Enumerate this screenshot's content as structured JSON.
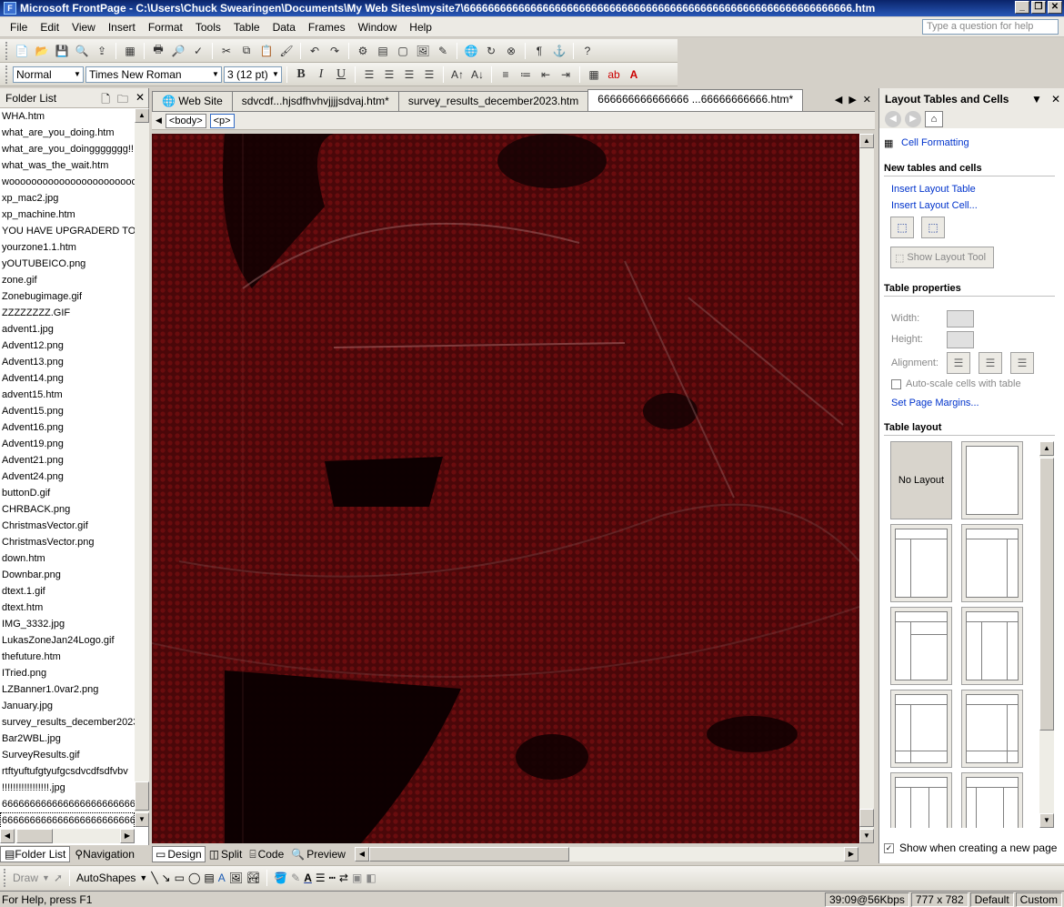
{
  "window": {
    "title": "Microsoft FrontPage - C:\\Users\\Chuck Swearingen\\Documents\\My Web Sites\\mysite7\\6666666666666666666666666666666666666666666666666666666666666666.htm"
  },
  "menu": {
    "items": [
      "File",
      "Edit",
      "View",
      "Insert",
      "Format",
      "Tools",
      "Table",
      "Data",
      "Frames",
      "Window",
      "Help"
    ],
    "help_placeholder": "Type a question for help"
  },
  "formatting": {
    "style": "Normal",
    "font": "Times New Roman",
    "size": "3  (12 pt)",
    "bold": "B",
    "italic": "I",
    "underline": "U"
  },
  "folder_list": {
    "title": "Folder List",
    "files": [
      "WHA.htm",
      "what_are_you_doing.htm",
      "what_are_you_doinggggggg!!",
      "what_was_the_wait.htm",
      "woooooooooooooooooooooooo",
      "xp_mac2.jpg",
      "xp_machine.htm",
      "YOU HAVE UPGRADERD TO PR",
      "yourzone1.1.htm",
      "yOUTUBEICO.png",
      "zone.gif",
      "Zonebugimage.gif",
      "ZZZZZZZZ.GIF",
      "advent1.jpg",
      "Advent12.png",
      "Advent13.png",
      "Advent14.png",
      "advent15.htm",
      "Advent15.png",
      "Advent16.png",
      "Advent19.png",
      "Advent21.png",
      "Advent24.png",
      "buttonD.gif",
      "CHRBACK.png",
      "ChristmasVector.gif",
      "ChristmasVector.png",
      "down.htm",
      "Downbar.png",
      "dtext.1.gif",
      "dtext.htm",
      "IMG_3332.jpg",
      "LukasZoneJan24Logo.gif",
      "thefuture.htm",
      "ITried.png",
      "LZBanner1.0var2.png",
      "January.jpg",
      "survey_results_december2023",
      "Bar2WBL.jpg",
      "SurveyResults.gif",
      "rtftyuftufgtyufgcsdvcdfsdfvbv",
      "!!!!!!!!!!!!!!!!!.jpg",
      "6666666666666666666666666",
      "6666666666666666666666666"
    ],
    "tab_folder": "Folder List",
    "tab_navigation": "Navigation"
  },
  "doc_tabs": [
    "Web Site",
    "sdvcdf...hjsdfhvhvjjjjsdvaj.htm*",
    "survey_results_december2023.htm",
    "666666666666666 ...66666666666.htm*"
  ],
  "tag_selector": [
    "<body>",
    "<p>"
  ],
  "view_tabs": [
    "Design",
    "Split",
    "Code",
    "Preview"
  ],
  "task_pane": {
    "title": "Layout Tables and Cells",
    "cell_formatting": "Cell Formatting",
    "section_new": "New tables and cells",
    "insert_layout_table": "Insert Layout Table",
    "insert_layout_cell": "Insert Layout Cell...",
    "show_layout_tool": "Show Layout Tool",
    "section_props": "Table properties",
    "width_label": "Width:",
    "height_label": "Height:",
    "alignment_label": "Alignment:",
    "autoscale": "Auto-scale cells with table",
    "set_margins": "Set Page Margins...",
    "section_layout": "Table layout",
    "no_layout": "No Layout",
    "show_when_new": "Show when creating a new page"
  },
  "drawing": {
    "draw": "Draw",
    "autoshapes": "AutoShapes"
  },
  "status": {
    "help": "For Help, press F1",
    "download": "39:09@56Kbps",
    "size": "777 x 782",
    "mode1": "Default",
    "mode2": "Custom"
  },
  "colors": {
    "canvas_bg": "#3a0507",
    "link": "#0033cc",
    "titlebar": "#0a246a"
  }
}
